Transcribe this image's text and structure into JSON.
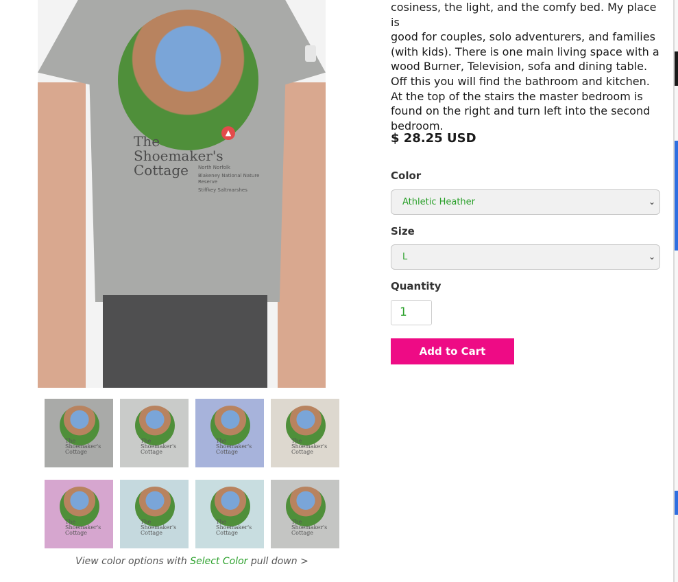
{
  "product": {
    "description_lines": [
      "cosiness, the light, and the comfy bed. My place is",
      "good for couples, solo adventurers, and families",
      "(with kids). There is one main living space with a",
      "wood Burner, Television, sofa and dining table.",
      "Off this you will find the bathroom and kitchen.",
      "At the top of the stairs the master bedroom is",
      "found on the right and turn left into the second",
      "bedroom."
    ],
    "price": "$ 28.25 USD"
  },
  "print": {
    "title_line1": "The",
    "title_line2": "Shoemaker's",
    "title_line3": "Cottage",
    "sub1": "North Norfolk",
    "sub2": "Blakeney National Nature Reserve",
    "sub3": "Stiffkey Saltmarshes"
  },
  "form": {
    "color_label": "Color",
    "color_value": "Athletic Heather",
    "size_label": "Size",
    "size_value": "L",
    "quantity_label": "Quantity",
    "quantity_value": "1",
    "add_to_cart": "Add to Cart"
  },
  "thumbnails": [
    {
      "color": "#a9aaa8"
    },
    {
      "color": "#c9cbc9"
    },
    {
      "color": "#a7b3db"
    },
    {
      "color": "#ddd8cf"
    },
    {
      "color": "#d6a6cf"
    },
    {
      "color": "#c5d9de"
    },
    {
      "color": "#c8dde0"
    },
    {
      "color": "#c4c5c3"
    }
  ],
  "thumb_text": "The Shoemaker's Cottage",
  "color_note": {
    "prefix": "View color options with",
    "link": "Select Color",
    "suffix": "pull down >"
  },
  "colors": {
    "accent_pink": "#ee0b85",
    "select_text_green": "#2aa02a",
    "tee_heather": "#a9aaa8"
  }
}
